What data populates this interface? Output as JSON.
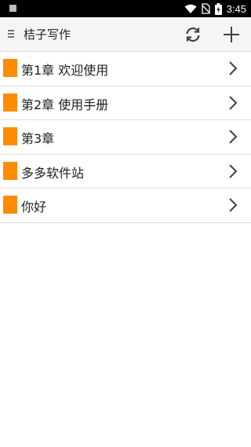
{
  "status_bar": {
    "time": "3:45",
    "icons": [
      "notification-icon",
      "wifi-icon",
      "no-sim-icon",
      "battery-charging-icon"
    ]
  },
  "app_bar": {
    "title": "桔子写作",
    "icons": [
      "menu-icon",
      "refresh-icon",
      "add-icon"
    ]
  },
  "chapters": [
    {
      "label": "第1章 欢迎使用"
    },
    {
      "label": "第2章 使用手册"
    },
    {
      "label": "第3章"
    },
    {
      "label": "多多软件站"
    },
    {
      "label": "你好"
    }
  ],
  "colors": {
    "marker": "#ff8c00",
    "app_bar_bg": "#f5f5f5",
    "status_bar_bg": "#000000"
  }
}
